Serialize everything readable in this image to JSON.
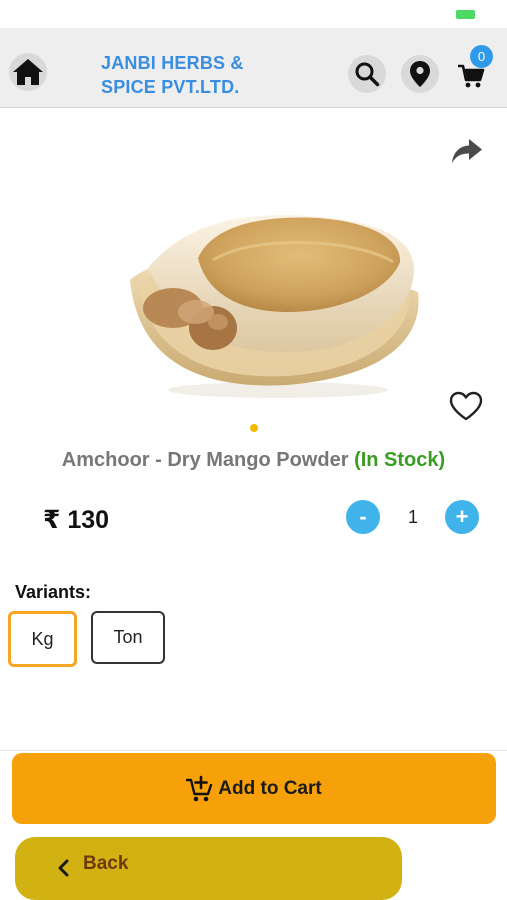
{
  "app": {
    "brand_line1": "JANBI HERBS &",
    "brand_line2": "SPICE PVT.LTD.",
    "cart_count": "0"
  },
  "icons": {
    "home": "home-icon",
    "search": "search-icon",
    "location": "location-pin-icon",
    "cart": "cart-icon",
    "share": "share-icon",
    "wishlist": "heart-outline-icon",
    "add_to_cart": "cart-plus-icon",
    "back": "chevron-left-icon"
  },
  "product": {
    "name": "Amchoor - Dry Mango Powder",
    "stock_status": "(In Stock)",
    "price": "₹ 130",
    "quantity": "1",
    "minus_label": "-",
    "plus_label": "+",
    "image_count": 1,
    "active_image_index": 0
  },
  "variants": {
    "label": "Variants:",
    "options": [
      "Kg",
      "Ton"
    ],
    "selected": "Kg"
  },
  "actions": {
    "add_to_cart_label": "Add to Cart",
    "back_label": "Back"
  },
  "colors": {
    "brand_blue": "#3a8ee0",
    "accent_orange": "#f7a10a",
    "back_gold": "#d1b212",
    "in_stock_green": "#3a9d23",
    "qty_blue": "#3fb3ea",
    "selected_variant_border": "#f5a623"
  }
}
